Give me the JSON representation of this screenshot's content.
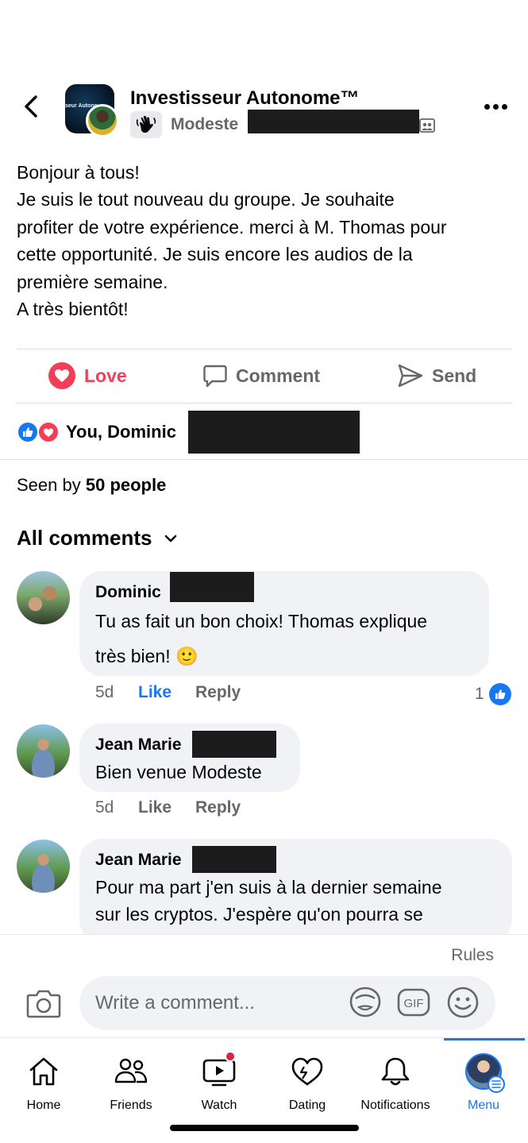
{
  "post": {
    "group_name": "Investisseur Autonome™",
    "group_avatar_text": "seur Autono",
    "author_name": "Modeste",
    "body_lines": [
      "Bonjour à tous!",
      "Je suis le tout nouveau du groupe. Je souhaite",
      "profiter de votre expérience. merci à M. Thomas pour",
      "cette opportunité. Je suis encore les audios de la",
      "première semaine.",
      "A très bientôt!"
    ]
  },
  "actions": {
    "love": "Love",
    "comment": "Comment",
    "send": "Send"
  },
  "reactions": {
    "text": "You, Dominic"
  },
  "seen": {
    "prefix": "Seen by",
    "count": "50 people"
  },
  "comments_header": "All comments",
  "comments": [
    {
      "name": "Dominic",
      "lines": [
        "Tu as fait un bon choix! Thomas explique",
        "très bien! 🙂"
      ],
      "time": "5d",
      "like": "Like",
      "reply": "Reply",
      "like_count": "1"
    },
    {
      "name": "Jean Marie",
      "lines": [
        "Bien venue Modeste"
      ],
      "time": "5d",
      "like": "Like",
      "reply": "Reply"
    },
    {
      "name": "Jean Marie",
      "lines": [
        "Pour ma part j'en suis à la dernier semaine",
        "sur les cryptos.  J'espère qu'on pourra se"
      ],
      "time": "",
      "like": "",
      "reply": ""
    }
  ],
  "composer": {
    "rules": "Rules",
    "placeholder": "Write a comment...",
    "gif": "GIF"
  },
  "nav": [
    {
      "label": "Home"
    },
    {
      "label": "Friends"
    },
    {
      "label": "Watch"
    },
    {
      "label": "Dating"
    },
    {
      "label": "Notifications"
    },
    {
      "label": "Menu"
    }
  ],
  "colors": {
    "accent": "#1877f2",
    "love": "#f33e58",
    "muted": "#65676b",
    "bubble": "#f0f2f5"
  }
}
